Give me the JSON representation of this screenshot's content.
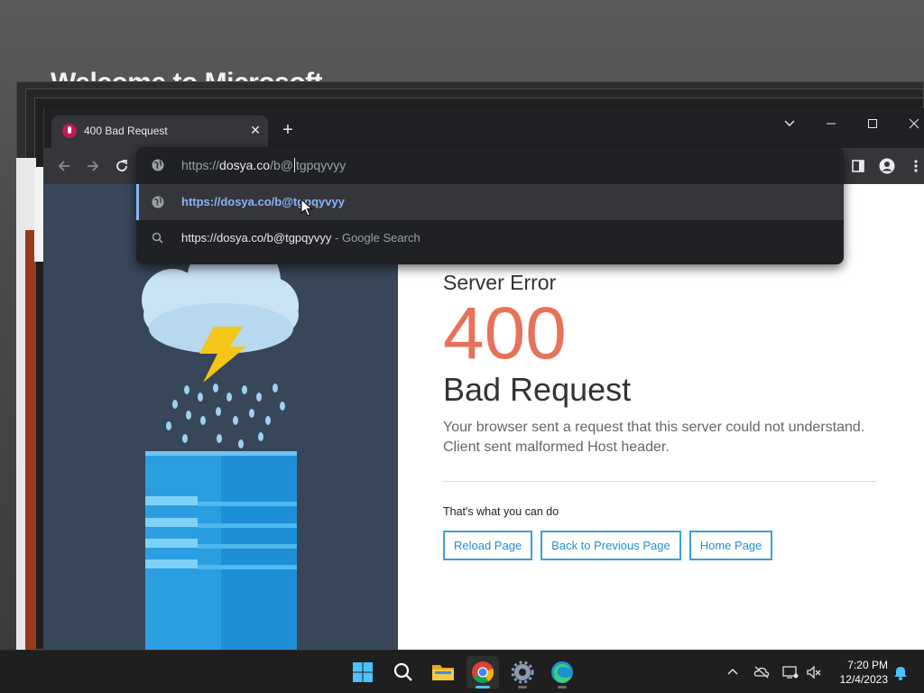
{
  "background": {
    "window_title": "Welcome to Microsoft"
  },
  "browser": {
    "tab": {
      "title": "400 Bad Request",
      "close": "✕"
    },
    "new_tab": "+",
    "window_controls": {
      "dropdown": "⌄",
      "minimize": "—",
      "maximize": "☐",
      "close": "✕"
    },
    "omnibox": {
      "prefix": "https://",
      "host": "dosya.co",
      "path_before_caret": "/b@",
      "path_after_caret": "tgpqyvyy",
      "suggestions": [
        {
          "icon": "globe-icon",
          "text": "https://dosya.co/b@tgpqyvyy",
          "suffix": ""
        },
        {
          "icon": "search-icon",
          "text": "https://dosya.co/b@tgpqyvyy",
          "suffix": " - Google Search"
        }
      ]
    }
  },
  "page": {
    "label": "Server Error",
    "code": "400",
    "title": "Bad Request",
    "description_line1": "Your browser sent a request that this server could not understand.",
    "description_line2": "Client sent malformed Host header.",
    "actions_label": "That's what you can do",
    "buttons": [
      "Reload Page",
      "Back to Previous Page",
      "Home Page"
    ]
  },
  "taskbar": {
    "apps": [
      "start-icon",
      "search-icon",
      "file-explorer-icon",
      "chrome-icon",
      "settings-icon",
      "edge-icon"
    ],
    "active_app": "chrome-icon",
    "time": "7:20 PM",
    "date": "12/4/2023"
  },
  "colors": {
    "error_code": "#e8715a",
    "button_border": "#3aa0d8",
    "suggestion_link": "#8ab4f8",
    "illustration_bg": "#374759"
  }
}
